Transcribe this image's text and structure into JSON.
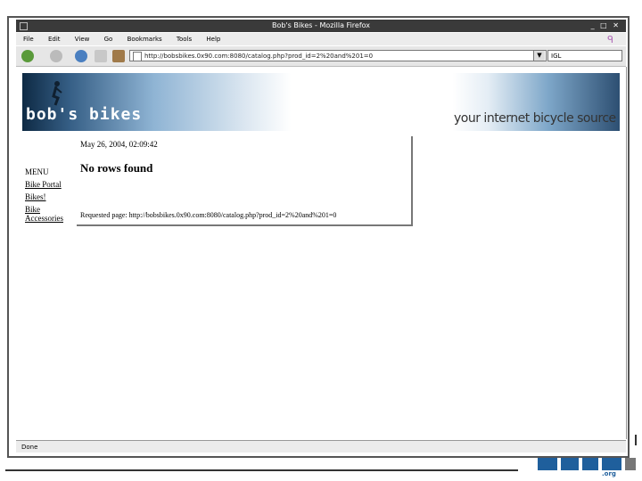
{
  "window": {
    "title": "Bob's Bikes - Mozilla Firefox"
  },
  "menubar": {
    "items": [
      "File",
      "Edit",
      "View",
      "Go",
      "Bookmarks",
      "Tools",
      "Help"
    ]
  },
  "toolbar": {
    "url": "http://bobsbikes.0x90.com:8080/catalog.php?prod_id=2%20and%201=0",
    "search_value": "IGL"
  },
  "banner": {
    "logo_text": "bob's bikes",
    "tagline": "your internet bicycle source"
  },
  "page": {
    "timestamp": "May 26, 2004, 02:09:42",
    "message": "No rows found",
    "requested_page": "Requested page: http://bobsbikes.0x90.com:8080/catalog.php?prod_id=2%20and%201=0"
  },
  "sidebar_menu": {
    "heading": "MENU",
    "links": [
      "Bike Portal",
      "Bikes!",
      "Bike Accessories"
    ]
  },
  "statusbar": {
    "text": "Done"
  },
  "colors": {
    "brand_blue": "#1f5f9c",
    "titlebar": "#3a3a3a"
  }
}
